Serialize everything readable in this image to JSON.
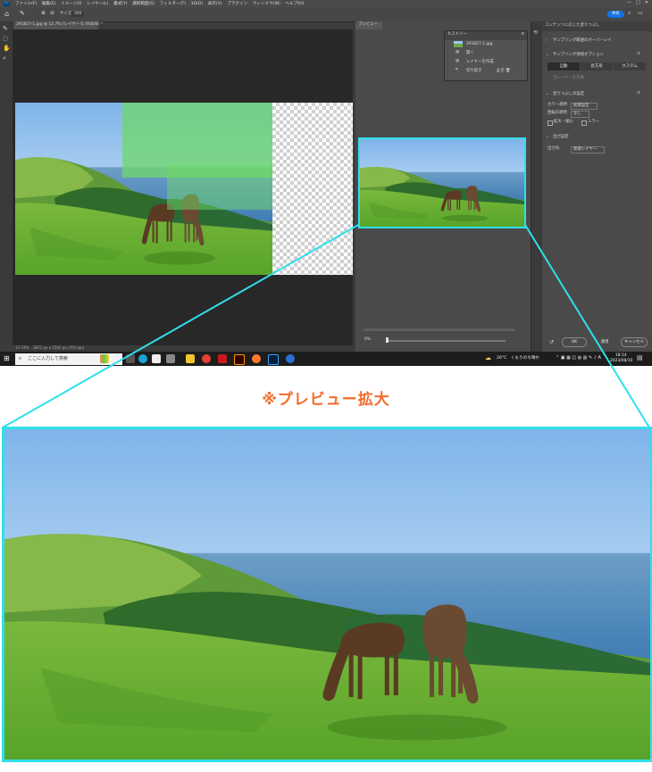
{
  "menubar": {
    "items": [
      "ファイル(F)",
      "編集(E)",
      "イメージ(I)",
      "レイヤー(L)",
      "書式(Y)",
      "選択範囲(S)",
      "フィルター(T)",
      "3D(D)",
      "表示(V)",
      "プラグイン",
      "ウィンドウ(W)",
      "ヘルプ(H)"
    ]
  },
  "optionsbar": {
    "size_label": "サイズ:",
    "size_value": "200",
    "share_label": "共有"
  },
  "document": {
    "tab_label": "291827-1.jpg @ 12.7% (レイヤー 0, RGB/8) *",
    "status_zoom": "12.74%",
    "status_info": "3872 px x 2592 px (350 ppi)"
  },
  "preview": {
    "tab_label": "プレビュー",
    "zoom_value": "0%"
  },
  "history": {
    "tab_label": "ヒストリー",
    "rows": [
      "291827-1.jpg",
      "開く",
      "レイヤーを作成",
      "切り抜き"
    ]
  },
  "props": {
    "title": "コンテンツに応じた塗りつぶし",
    "sec_sampling_overlay": "サンプリング範囲のオーバーレイ",
    "sec_sampling_options": "サンプリング領域オプション",
    "seg": [
      "自動",
      "長方形",
      "カスタム"
    ],
    "sample_all_layers": "全レイヤーを対象",
    "sec_fill": "塗りつぶしの設定",
    "color_adapt_label": "カラー適用",
    "color_adapt_value": "初期設定",
    "rotation_label": "回転の適用",
    "rotation_value": "なし",
    "scale_label": "拡大・縮小",
    "mirror_label": "ミラー",
    "sec_output": "出力設定",
    "output_label": "出力先:",
    "output_value": "新規レイヤー",
    "ok": "OK",
    "apply": "適用",
    "cancel": "キャンセル"
  },
  "taskbar": {
    "search_placeholder": "ここに入力して検索",
    "weather": "26°C　くもりのち晴れ",
    "time": "18:14",
    "date": "2023/08/10"
  },
  "callout": {
    "label": "※プレビュー拡大"
  },
  "colors": {
    "accent": "#2fe0ea",
    "label": "#f26a2b",
    "ps_panel": "#4a4a4a"
  }
}
